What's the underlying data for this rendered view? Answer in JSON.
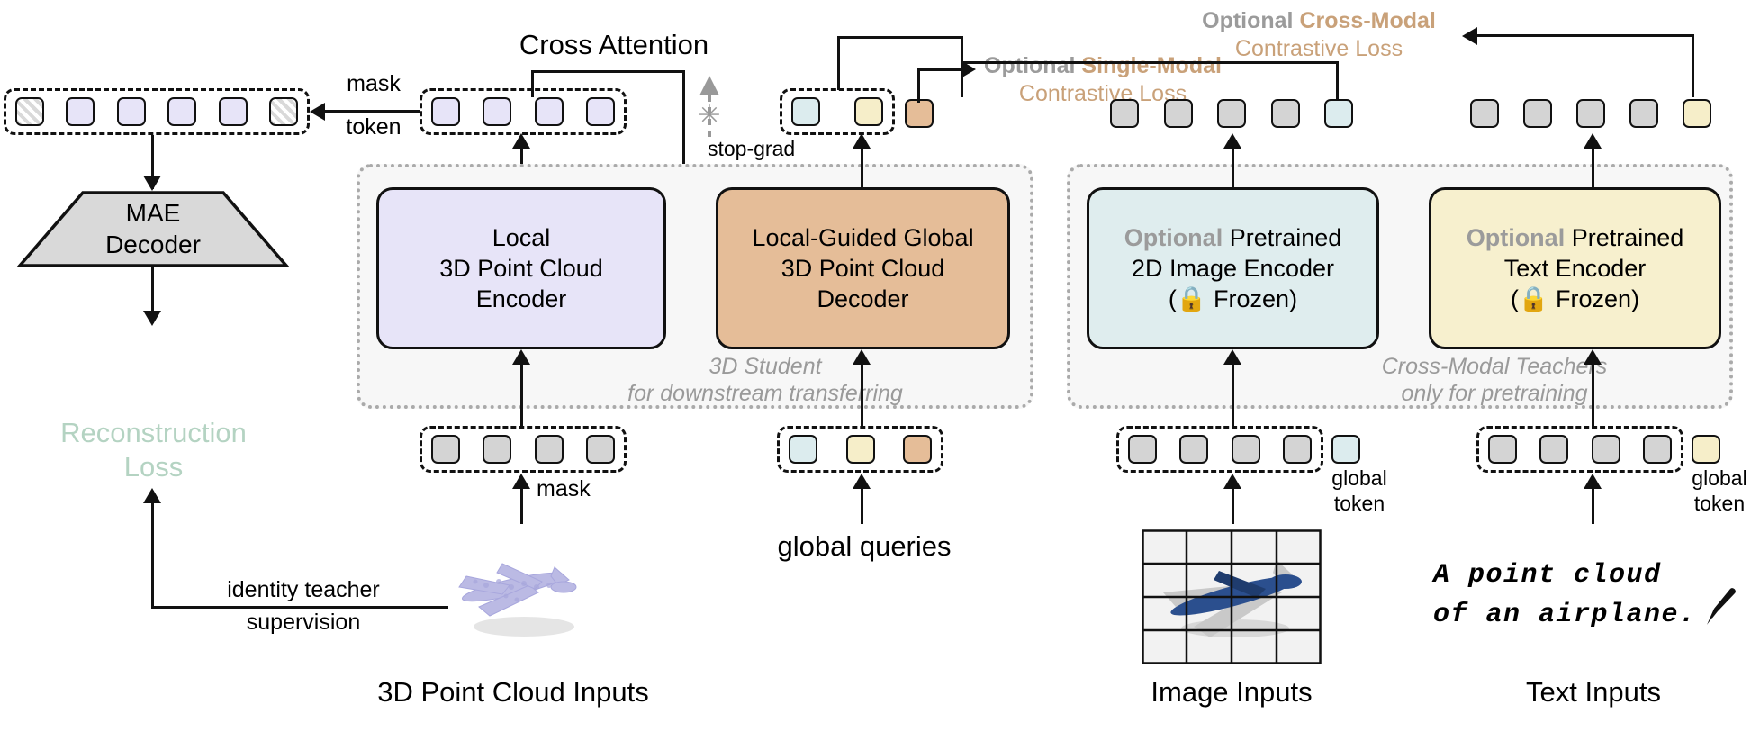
{
  "figure": {
    "title_labels": {
      "cross_attention": "Cross Attention",
      "mask_token": "mask\ntoken",
      "mask_token_line1": "mask",
      "mask_token_line2": "token",
      "stop_grad": "stop-grad",
      "mask": "mask",
      "global_queries": "global queries",
      "global_token_line1": "global",
      "global_token_line2": "token",
      "reconstruction_loss_line1": "Reconstruction",
      "reconstruction_loss_line2": "Loss",
      "identity_teacher_line1": "identity teacher",
      "identity_teacher_line2": "supervision"
    },
    "modules": {
      "mae_decoder": {
        "line1": "MAE",
        "line2": "Decoder"
      },
      "local_encoder": {
        "line1": "Local",
        "line2": "3D Point Cloud",
        "line3": "Encoder"
      },
      "global_decoder": {
        "line1": "Local-Guided Global",
        "line2": "3D Point Cloud",
        "line3": "Decoder"
      },
      "image_encoder": {
        "optional": "Optional",
        "rest": " Pretrained",
        "line2": "2D Image Encoder",
        "line3_lock": "🔒",
        "line3": "( Frozen)",
        "line3_pre": "(",
        "line3_post": " Frozen)"
      },
      "text_encoder": {
        "optional": "Optional",
        "rest": " Pretrained",
        "line2": "Text Encoder",
        "line3_pre": "(",
        "line3_post": " Frozen)"
      }
    },
    "panels": {
      "student": {
        "line1": "3D Student",
        "line2": "for downstream transferring"
      },
      "teachers": {
        "line1": "Cross-Modal Teachers",
        "line2": "only for pretraining"
      }
    },
    "losses": {
      "single_modal": {
        "optional": "Optional",
        "kind": "Single-Modal",
        "line2": "Contrastive Loss"
      },
      "cross_modal": {
        "optional": "Optional",
        "kind": "Cross-Modal",
        "line2": "Contrastive Loss"
      }
    },
    "captions": {
      "pointcloud_inputs": "3D Point Cloud Inputs",
      "image_inputs": "Image Inputs",
      "text_inputs": "Text Inputs",
      "text_prompt_line1": "A point cloud",
      "text_prompt_line2": "of an airplane."
    },
    "icons": {
      "lock": "🔒",
      "pen": "✒",
      "stop_grad_mark": "✳"
    },
    "colors": {
      "lavender": "#e7e4f8",
      "tan": "#e5bd98",
      "cyan": "#dfedee",
      "yellow": "#f7f0ce",
      "gray_token": "#d4d4d4",
      "loss_text": "#c9a179",
      "optional_text": "#9b9b9b",
      "reconstruction_text": "#b4d3c2",
      "panel_border": "#aaaaaa"
    },
    "token_rows": {
      "mae_input": [
        "hatch",
        "lav",
        "lav",
        "lav",
        "lav",
        "hatch"
      ],
      "encoder_output": [
        "lav",
        "lav",
        "lav",
        "lav"
      ],
      "encoder_input": [
        "gray",
        "gray",
        "gray",
        "gray"
      ],
      "decoder_output_group": [
        "cyan",
        "yellow"
      ],
      "decoder_output_extra": [
        "tan"
      ],
      "decoder_input": [
        "cyan",
        "yellow",
        "tan"
      ],
      "image_tokens": [
        "gray",
        "gray",
        "gray",
        "gray"
      ],
      "image_global_token": [
        "cyan"
      ],
      "text_tokens": [
        "gray",
        "gray",
        "gray",
        "gray"
      ],
      "text_global_token": [
        "yellow"
      ],
      "image_encoder_input": [
        "gray",
        "gray",
        "gray",
        "gray"
      ],
      "image_encoder_input_global": [
        "cyan"
      ],
      "text_encoder_input": [
        "gray",
        "gray",
        "gray",
        "gray"
      ],
      "text_encoder_input_global": [
        "yellow"
      ]
    }
  }
}
